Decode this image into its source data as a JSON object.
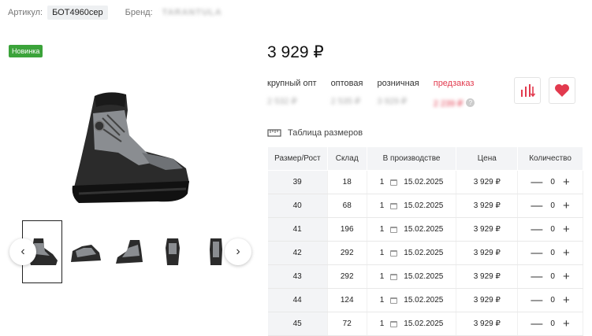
{
  "header": {
    "sku_label": "Артикул:",
    "sku_value": "БОТ4960сер",
    "brand_label": "Бренд:",
    "brand_value": "TARANTULA"
  },
  "badge": "Новинка",
  "price": "3 929 ₽",
  "price_levels": [
    {
      "title": "крупный опт",
      "value": "2 532 ₽"
    },
    {
      "title": "оптовая",
      "value": "2 535 ₽"
    },
    {
      "title": "розничная",
      "value": "3 929 ₽"
    },
    {
      "title": "предзаказ",
      "value": "2 239 ₽"
    }
  ],
  "qmark": "?",
  "size_table_label": "Таблица размеров",
  "table": {
    "headers": [
      "Размер/Рост",
      "Склад",
      "В производстве",
      "Цена",
      "Количество"
    ],
    "rows": [
      {
        "size": "39",
        "stock": "18",
        "prod_qty": "1",
        "prod_date": "15.02.2025",
        "price": "3 929 ₽",
        "qty": "0"
      },
      {
        "size": "40",
        "stock": "68",
        "prod_qty": "1",
        "prod_date": "15.02.2025",
        "price": "3 929 ₽",
        "qty": "0"
      },
      {
        "size": "41",
        "stock": "196",
        "prod_qty": "1",
        "prod_date": "15.02.2025",
        "price": "3 929 ₽",
        "qty": "0"
      },
      {
        "size": "42",
        "stock": "292",
        "prod_qty": "1",
        "prod_date": "15.02.2025",
        "price": "3 929 ₽",
        "qty": "0"
      },
      {
        "size": "43",
        "stock": "292",
        "prod_qty": "1",
        "prod_date": "15.02.2025",
        "price": "3 929 ₽",
        "qty": "0"
      },
      {
        "size": "44",
        "stock": "124",
        "prod_qty": "1",
        "prod_date": "15.02.2025",
        "price": "3 929 ₽",
        "qty": "0"
      },
      {
        "size": "45",
        "stock": "72",
        "prod_qty": "1",
        "prod_date": "15.02.2025",
        "price": "3 929 ₽",
        "qty": "0"
      }
    ]
  },
  "qty_minus": "—",
  "qty_plus": "+",
  "icons": {
    "prev": "chevron-left-icon",
    "next": "chevron-right-icon",
    "compare": "compare-bars-icon",
    "favorite": "heart-icon",
    "size_table": "ruler-icon",
    "calendar": "calendar-icon"
  },
  "colors": {
    "accent_red": "#e23a4e",
    "stock_green": "#3a9a2e",
    "badge_green": "#3ba33a"
  }
}
